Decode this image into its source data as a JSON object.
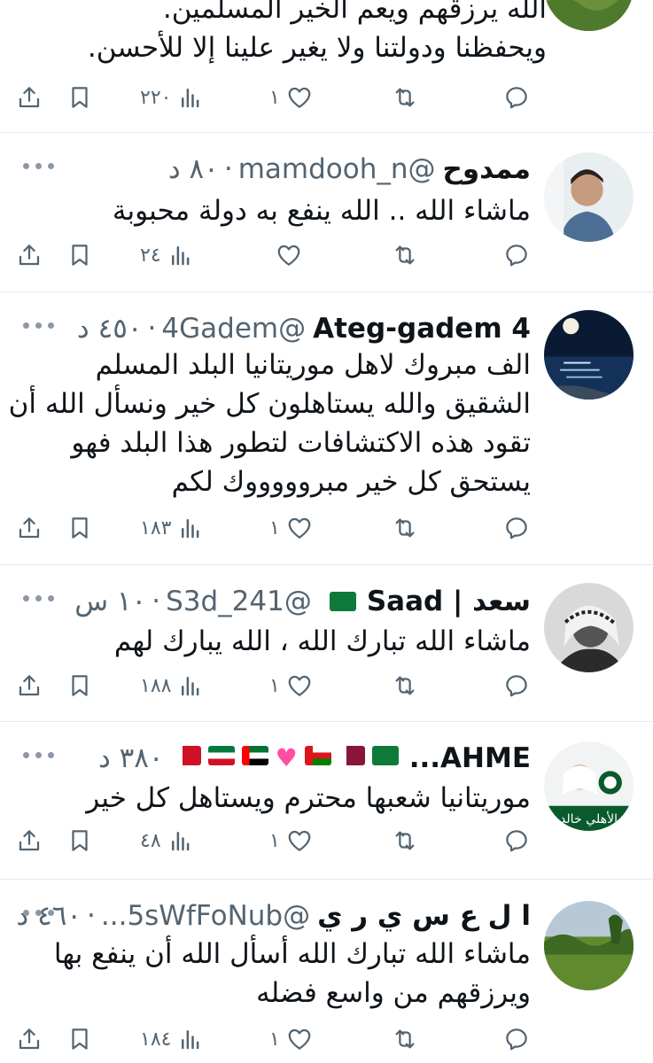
{
  "tweets": [
    {
      "lines": [
        "الله يرزقهم ويعم الخير المسلمين.",
        "ويحفظنا ودولتنا ولا يغير علينا إلا للأحسن."
      ],
      "views": "٢٢٠",
      "likes": "١"
    },
    {
      "name": "ممدوح",
      "handle": "@mamdooh_n",
      "time": "٨٠ د",
      "lines": [
        "ماشاء الله .. الله ينفع به دولة محبوبة"
      ],
      "views": "٢٤",
      "likes": ""
    },
    {
      "name": "Ateg-gadem 4",
      "handle": "@4Gadem",
      "time": "٤٥٠ د",
      "lines": [
        "الف مبروك لاهل موريتانيا البلد المسلم",
        "الشقيق والله يستاهلون كل خير ونسأل الله أن",
        "تقود هذه الاكتشافات لتطور هذا البلد فهو",
        "يستحق كل خير مبروووووك لكم"
      ],
      "views": "١٨٣",
      "likes": "١"
    },
    {
      "name": "سعد | Saad",
      "handle": "@S3d_241",
      "time": "١٠ س",
      "lines": [
        "ماشاء الله تبارك الله ، الله يبارك لهم"
      ],
      "views": "١٨٨",
      "likes": "١"
    },
    {
      "name": "AHME...",
      "handle": "",
      "time": "٣٨٠ د",
      "lines": [
        "موريتانيا شعبها محترم ويستاهل كل خير"
      ],
      "views": "٤٨",
      "likes": "١"
    },
    {
      "name": "ا ل ع س ي ر ي",
      "handle": "@5sWfFoNub...",
      "time": "٤٦٠ د",
      "lines": [
        "ماشاء الله تبارك الله أسأل الله أن ينفع بها",
        "ويرزقهم من واسع فضله"
      ],
      "views": "١٨٤",
      "likes": "١"
    }
  ],
  "avatar_text": "الأهلي خالد",
  "icons": [
    "reply-icon",
    "retweet-icon",
    "like-icon",
    "views-icon",
    "bookmark-icon",
    "share-icon"
  ],
  "colors": {
    "text": "#0f1419",
    "muted": "#536471",
    "divider": "#e6e9ec"
  }
}
